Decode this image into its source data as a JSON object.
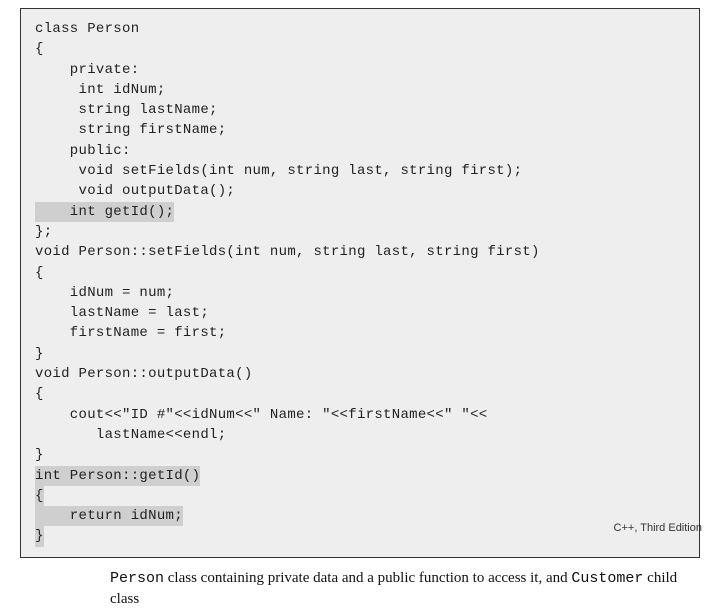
{
  "code": {
    "l1": "class Person",
    "l2": "{",
    "l3": "    private:",
    "l4": "     int idNum;",
    "l5": "     string lastName;",
    "l6": "     string firstName;",
    "l7": "    public:",
    "l8": "     void setFields(int num, string last, string first);",
    "l9": "     void outputData();",
    "l10": "    int getId();",
    "l11": "};",
    "l12": "void Person::setFields(int num, string last, string first)",
    "l13": "{",
    "l14": "    idNum = num;",
    "l15": "    lastName = last;",
    "l16": "    firstName = first;",
    "l17": "}",
    "l18": "void Person::outputData()",
    "l19": "{",
    "l20": "    cout<<\"ID #\"<<idNum<<\" Name: \"<<firstName<<\" \"<<",
    "l21": "       lastName<<endl;",
    "l22": "}",
    "l23": "int Person::getId()",
    "l24": "{",
    "l25": "    return idNum;",
    "l26": "}"
  },
  "caption": {
    "pre": "",
    "mono1": "Person",
    "mid1": " class containing private data and a public function to access it, and ",
    "mono2": "Customer",
    "mid2": " child class"
  },
  "footer": "C++, Third Edition"
}
